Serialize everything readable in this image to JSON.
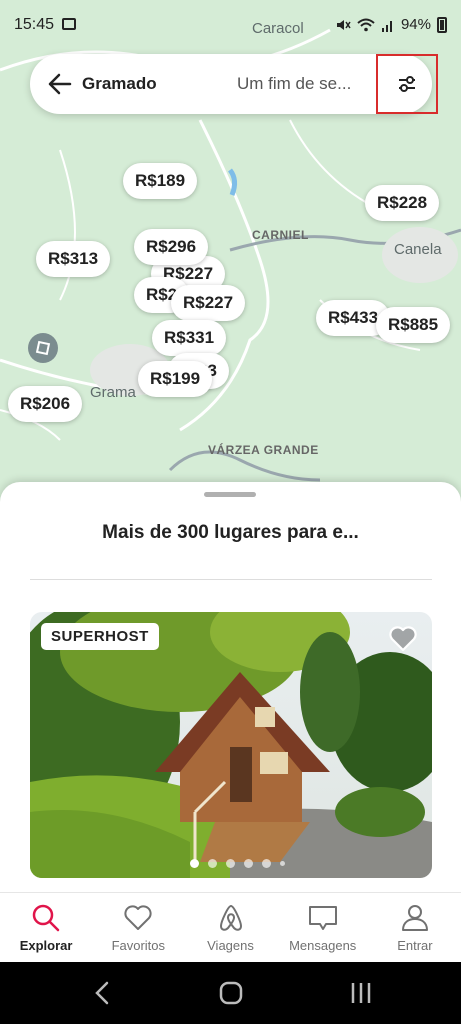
{
  "status": {
    "time": "15:45",
    "battery": "94%"
  },
  "map": {
    "labels": {
      "caracol": "Caracol",
      "carniel": "CARNIEL",
      "canela": "Canela",
      "gramado": "Grama",
      "varzea": "VÁRZEA GRANDE"
    },
    "pins": [
      "R$189",
      "R$228",
      "R$296",
      "R$313",
      "R$227",
      "R$2",
      "R$227",
      "R$331",
      "R$433",
      "R$885",
      "83",
      "R$199",
      "R$206"
    ]
  },
  "search": {
    "location": "Gramado",
    "dates": "Um fim de se..."
  },
  "sheet": {
    "title": "Mais de 300 lugares para e..."
  },
  "listing": {
    "badge": "SUPERHOST"
  },
  "nav": [
    {
      "label": "Explorar",
      "icon": "search-icon"
    },
    {
      "label": "Favoritos",
      "icon": "heart-icon"
    },
    {
      "label": "Viagens",
      "icon": "airbnb-logo-icon"
    },
    {
      "label": "Mensagens",
      "icon": "message-icon"
    },
    {
      "label": "Entrar",
      "icon": "user-icon"
    }
  ],
  "colors": {
    "accent": "#e0144a",
    "map_green": "#d4ebd4",
    "filter_highlight": "#d82c2c"
  }
}
